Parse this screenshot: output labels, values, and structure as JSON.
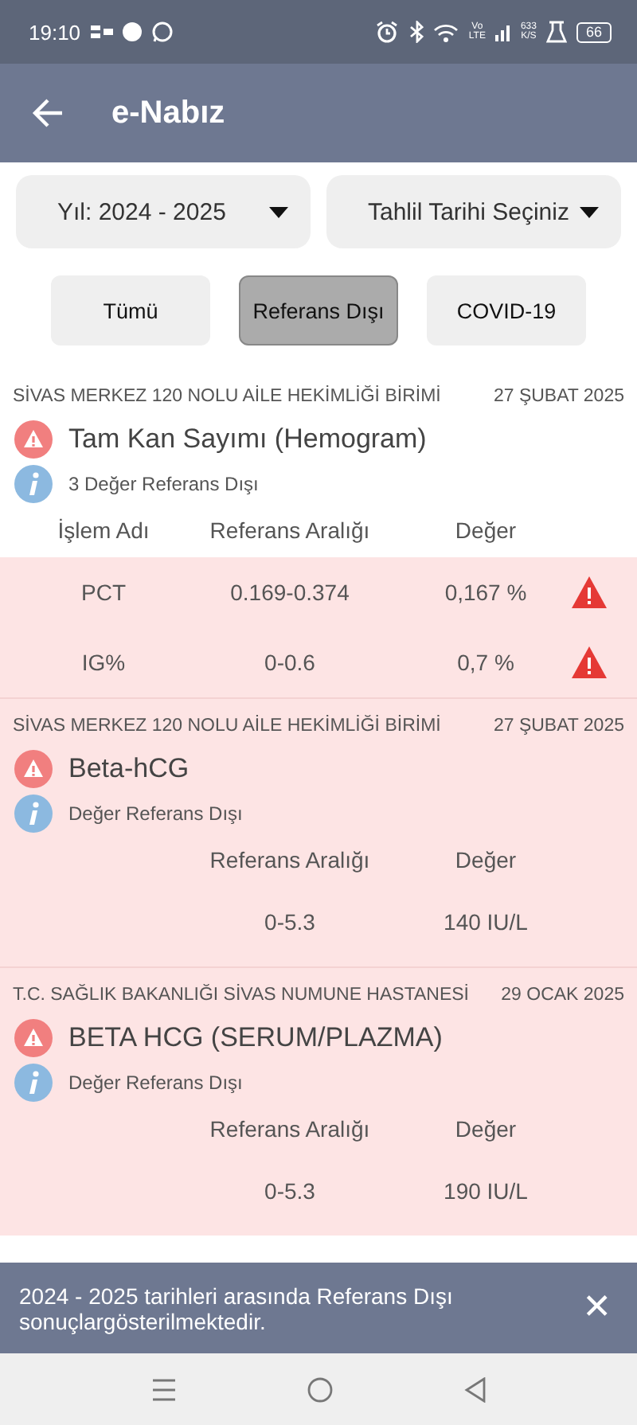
{
  "status_bar": {
    "time": "19:10",
    "network": [
      "Vo",
      "LTE"
    ],
    "speed": [
      "633",
      "K/S"
    ],
    "battery": "66"
  },
  "app_bar": {
    "title": "e-Nabız"
  },
  "filters": [
    {
      "label": "Yıl: 2024 - 2025"
    },
    {
      "label": "Tahlil Tarihi Seçiniz"
    }
  ],
  "tabs": [
    {
      "label": "Tümü",
      "selected": false
    },
    {
      "label": "Referans Dışı",
      "selected": true
    },
    {
      "label": "COVID-19",
      "selected": false
    }
  ],
  "results": [
    {
      "source": "SİVAS MERKEZ 120 NOLU AİLE HEKİMLİĞİ BİRİMİ",
      "date": "27 ŞUBAT 2025",
      "title": "Tam Kan Sayımı (Hemogram)",
      "info": "3 Değer Referans Dışı",
      "headings": {
        "name": "İşlem Adı",
        "range": "Referans Aralığı",
        "value": "Değer"
      },
      "rows": [
        {
          "name": "PCT",
          "range": "0.169-0.374",
          "value": "0,167 %",
          "flagged": true
        },
        {
          "name": "IG%",
          "range": "0-0.6",
          "value": "0,7 %",
          "flagged": true
        }
      ]
    },
    {
      "source": "SİVAS MERKEZ 120 NOLU AİLE HEKİMLİĞİ BİRİMİ",
      "date": "27 ŞUBAT 2025",
      "title": "Beta-hCG",
      "info": "Değer Referans Dışı",
      "highlighted": true,
      "headings": {
        "range": "Referans Aralığı",
        "value": "Değer"
      },
      "rows": [
        {
          "range": "0-5.3",
          "value": "140 IU/L"
        }
      ]
    },
    {
      "source": "T.C. SAĞLIK BAKANLIĞI SİVAS NUMUNE HASTANESİ",
      "date": "29 OCAK 2025",
      "title": "BETA HCG (SERUM/PLAZMA)",
      "info": "Değer Referans Dışı",
      "highlighted": true,
      "headings": {
        "range": "Referans Aralığı",
        "value": "Değer"
      },
      "rows": [
        {
          "range": "0-5.3",
          "value": "190 IU/L"
        }
      ]
    }
  ],
  "snackbar": {
    "message": "2024 - 2025 tarihleri arasında Referans Dışı sonuçlargösterilmektedir.",
    "close": "✕"
  }
}
